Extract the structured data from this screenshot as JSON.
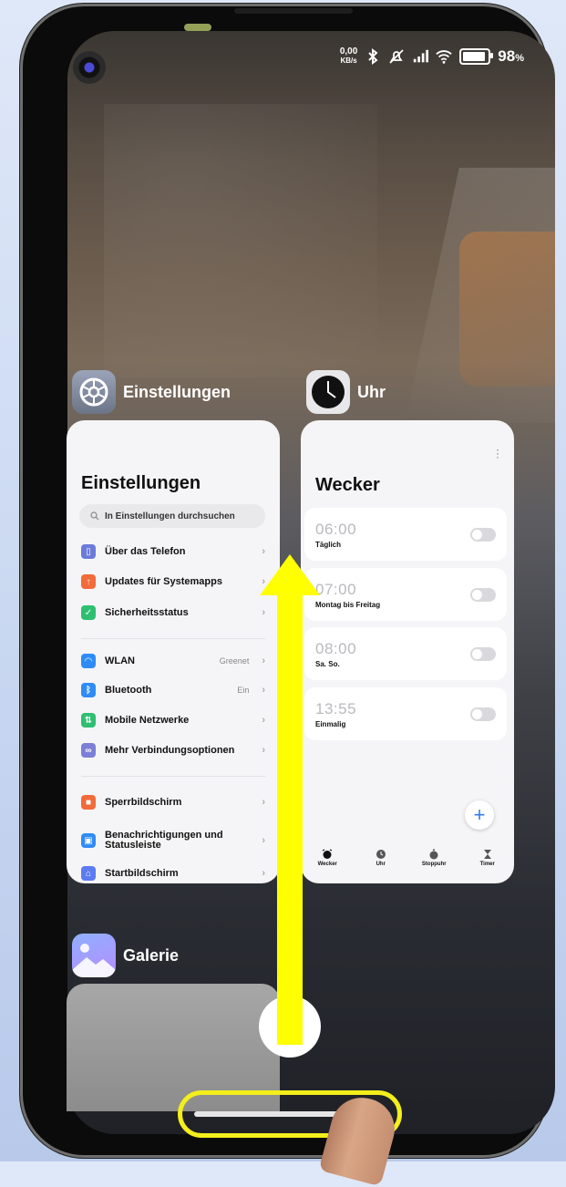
{
  "status_bar": {
    "net_speed_value": "0,00",
    "net_speed_unit": "KB/s",
    "battery_percent": "98",
    "battery_unit": "%",
    "battery_level": 0.98,
    "icons": [
      "bluetooth-icon",
      "no-ring-icon",
      "signal-icon",
      "wifi-icon",
      "battery-icon"
    ]
  },
  "recents": {
    "apps": [
      {
        "label": "Einstellungen",
        "icon": "gear-icon",
        "card": {
          "title": "Einstellungen",
          "search_placeholder": "In Einstellungen durchsuchen",
          "rows": [
            {
              "label": "Über das Telefon",
              "value": "",
              "icon": "phone-info-icon",
              "color": "#6b7bd9"
            },
            {
              "label": "Updates für Systemapps",
              "value": "",
              "icon": "arrow-up-icon",
              "color": "#f26b3a"
            },
            {
              "label": "Sicherheitsstatus",
              "value": "",
              "icon": "shield-icon",
              "color": "#2fbf71"
            },
            {
              "label": "WLAN",
              "value": "Greenet",
              "icon": "wifi-icon",
              "color": "#2f8cf6"
            },
            {
              "label": "Bluetooth",
              "value": "Ein",
              "icon": "bluetooth-icon",
              "color": "#2f8cf6"
            },
            {
              "label": "Mobile Netzwerke",
              "value": "",
              "icon": "mobile-data-icon",
              "color": "#2fbf71"
            },
            {
              "label": "Mehr Verbindungsoptionen",
              "value": "",
              "icon": "link-icon",
              "color": "#7c7fd6"
            },
            {
              "label": "Sperrbildschirm",
              "value": "",
              "icon": "lock-icon",
              "color": "#f26b3a"
            },
            {
              "label": "Benachrichtigungen und Statusleiste",
              "value": "",
              "icon": "notification-icon",
              "color": "#2f8cf6"
            },
            {
              "label": "Startbildschirm",
              "value": "",
              "icon": "home-icon",
              "color": "#5b7bf2"
            }
          ]
        }
      },
      {
        "label": "Uhr",
        "icon": "clock-icon",
        "card": {
          "title": "Wecker",
          "alarms": [
            {
              "time": "06:00",
              "repeat": "Täglich",
              "enabled": false
            },
            {
              "time": "07:00",
              "repeat": "Montag bis Freitag",
              "enabled": false
            },
            {
              "time": "08:00",
              "repeat": "Sa. So.",
              "enabled": false
            },
            {
              "time": "13:55",
              "repeat": "Einmalig",
              "enabled": false
            }
          ],
          "fab_label": "+",
          "tabs": [
            {
              "label": "Wecker",
              "icon": "alarm-icon"
            },
            {
              "label": "Uhr",
              "icon": "clock-icon"
            },
            {
              "label": "Stoppuhr",
              "icon": "stopwatch-icon"
            },
            {
              "label": "Timer",
              "icon": "hourglass-icon"
            }
          ]
        }
      },
      {
        "label": "Galerie",
        "icon": "gallery-icon"
      }
    ]
  },
  "annotations": {
    "arrow_color": "#ffff00",
    "highlight_color": "#f3ee1c"
  }
}
